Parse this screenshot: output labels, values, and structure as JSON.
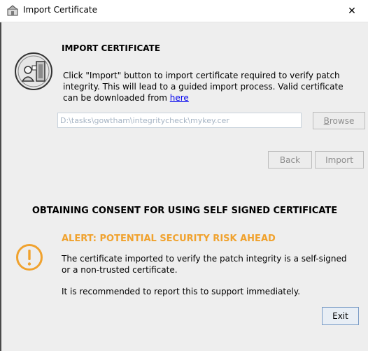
{
  "window": {
    "title": "Import Certificate",
    "close_glyph": "✕"
  },
  "import_section": {
    "heading": "IMPORT CERTIFICATE",
    "description": "Click \"Import\" button to import certificate required to verify patch integrity. This will lead to a guided import process. Valid certificate can be downloaded from ",
    "link_text": "here",
    "path_value": "D:\\tasks\\gowtham\\integritycheck\\mykey.cer",
    "browse_first": "B",
    "browse_rest": "rowse",
    "back_label": "Back",
    "import_label": "Import"
  },
  "consent_section": {
    "heading": "OBTAINING CONSENT FOR USING SELF SIGNED CERTIFICATE",
    "alert_title": "ALERT: POTENTIAL SECURITY RISK AHEAD",
    "alert_text": "The certificate imported to verify the patch integrity is a self-signed or a non-trusted certificate.",
    "recommendation": "It is recommended to report this to support immediately.",
    "exit_label": "Exit"
  },
  "colors": {
    "alert": "#f0a22e",
    "link": "#0000ee",
    "disabled_text": "#8c8c8c"
  },
  "icons": [
    "app-icon",
    "certificate-icon",
    "warning-icon",
    "close-icon"
  ]
}
